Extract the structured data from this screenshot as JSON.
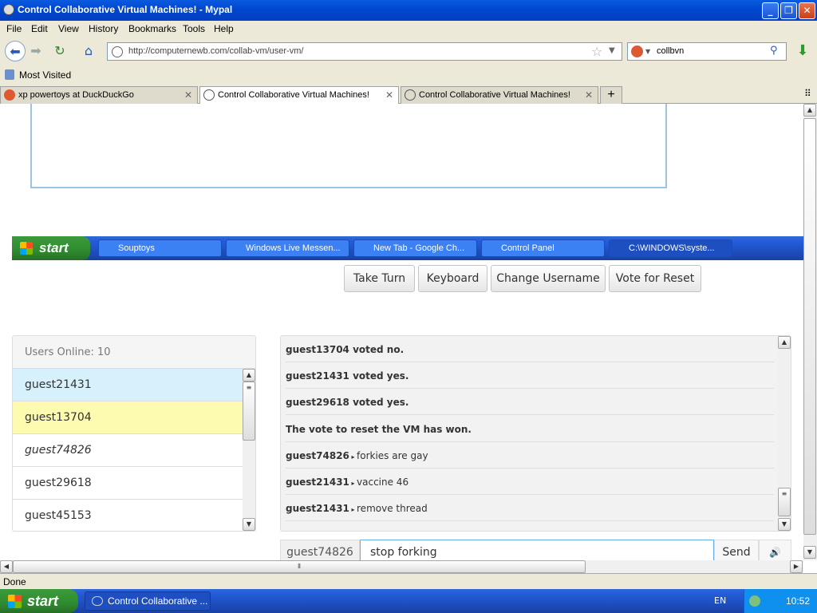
{
  "window": {
    "title": "Control Collaborative Virtual Machines! - Mypal"
  },
  "menu": [
    "File",
    "Edit",
    "View",
    "History",
    "Bookmarks",
    "Tools",
    "Help"
  ],
  "nav": {
    "url": "http://computernewb.com/collab-vm/user-vm/",
    "search_value": "collbvn"
  },
  "bookmarks": {
    "most_visited": "Most Visited"
  },
  "tabs": [
    {
      "label": "xp powertoys at DuckDuckGo"
    },
    {
      "label": "Control Collaborative Virtual Machines!"
    },
    {
      "label": "Control Collaborative Virtual Machines!"
    }
  ],
  "vm_taskbar": {
    "start": "start",
    "tasks": [
      "Souptoys",
      "Windows Live Messen...",
      "New Tab - Google Ch...",
      "Control Panel",
      "C:\\WINDOWS\\syste..."
    ]
  },
  "vm_buttons": [
    "Take Turn",
    "Keyboard",
    "Change Username",
    "Vote for Reset"
  ],
  "users": {
    "header": "Users Online: 10",
    "list": [
      "guest21431",
      "guest13704",
      "guest74826",
      "guest29618",
      "guest45153"
    ]
  },
  "chat": {
    "messages": [
      {
        "user": "guest13704 voted no.",
        "text": ""
      },
      {
        "user": "guest21431 voted yes.",
        "text": ""
      },
      {
        "user": "guest29618 voted yes.",
        "text": ""
      },
      {
        "user": "The vote to reset the VM has won.",
        "text": ""
      },
      {
        "user": "guest74826",
        "text": "forkies are gay"
      },
      {
        "user": "guest21431",
        "text": "vaccine 46"
      },
      {
        "user": "guest21431",
        "text": "remove thread"
      }
    ],
    "username": "guest74826",
    "input_value": "stop forking",
    "send_label": "Send"
  },
  "status": {
    "text": "Done"
  },
  "os_taskbar": {
    "start": "start",
    "task": "Control Collaborative ...",
    "lang": "EN",
    "clock": "10:52"
  },
  "colors": {
    "title_blue": "#0a5be0",
    "highlight_blue": "#d6f1fb",
    "highlight_yellow": "#fdfbb0"
  }
}
